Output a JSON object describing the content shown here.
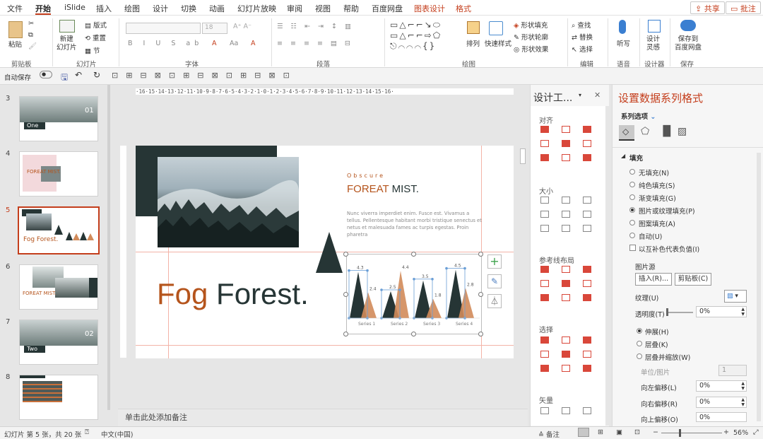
{
  "menu": {
    "tabs": [
      "文件",
      "开始",
      "iSlide",
      "插入",
      "绘图",
      "设计",
      "切换",
      "动画",
      "幻灯片放映",
      "审阅",
      "视图",
      "帮助",
      "百度网盘",
      "图表设计",
      "格式"
    ],
    "active": "开始",
    "share": "共享",
    "comment": "批注"
  },
  "ribbon": {
    "groups": {
      "clipboard": "剪贴板",
      "slides": "幻灯片",
      "font": "字体",
      "paragraph": "段落",
      "drawing": "绘图",
      "editing": "编辑",
      "voice": "语音",
      "designer": "设计器",
      "save": "保存"
    },
    "paste": "粘贴",
    "new_slide": "新建\n幻灯片",
    "layout": "版式",
    "reset": "重置",
    "section": "节",
    "font_size": "18",
    "arrange": "排列",
    "quick_styles": "快速样式",
    "shape_fill": "形状填充",
    "shape_outline": "形状轮廓",
    "shape_effects": "形状效果",
    "find": "查找",
    "replace": "替换",
    "select": "选择",
    "dictate": "听写",
    "design_ideas": "设计\n灵感",
    "save_to": "保存到\n百度网盘"
  },
  "qat": {
    "autosave": "自动保存"
  },
  "slides_panel": {
    "items": [
      {
        "num": "3",
        "label": "One",
        "badge": "01"
      },
      {
        "num": "4",
        "label": "FOREAT MIST."
      },
      {
        "num": "5",
        "label": "Fog Forest.",
        "selected": true
      },
      {
        "num": "6",
        "label": "FOREAT MIST."
      },
      {
        "num": "7",
        "label": "Two",
        "badge": "02"
      },
      {
        "num": "8",
        "label": ""
      }
    ]
  },
  "ruler": {
    "h": "·16·15·14·13·12·11·10·9·8·7·6·5·4·3·2·1·0·1·2·3·4·5·6·7·8·9·10·11·12·13·14·15·16·"
  },
  "slide": {
    "eyebrow": "Obscure",
    "heading_accent": "FOREAT",
    "heading_rest": " MIST.",
    "body": "Nunc viverra imperdiet enim. Fusce est. Vivamus a tellus. Pellentesque habitant morbi tristique senectus et netus et malesuada fames ac turpis egestas. Proin pharetra",
    "title_accent": "Fog",
    "title_rest": " Forest.",
    "colors": {
      "accent": "#b5541c",
      "dark": "#263535",
      "orange": "#d28b5a"
    }
  },
  "chart_data": {
    "type": "area",
    "categories": [
      "Series 1",
      "Series 2",
      "Series 3",
      "Series 4"
    ],
    "series": [
      {
        "values": [
          4.3,
          2.5,
          3.5,
          4.5
        ],
        "color": "#263535"
      },
      {
        "values": [
          2.4,
          4.4,
          1.8,
          2.8
        ],
        "color": "#d28b5a"
      }
    ],
    "ylim": [
      0,
      5
    ]
  },
  "notes": {
    "placeholder": "单击此处添加备注"
  },
  "design_pane": {
    "title": "设计工...",
    "sections": [
      "对齐",
      "大小",
      "参考线布局",
      "选择",
      "矢量"
    ]
  },
  "format_pane": {
    "title": "设置数据系列格式",
    "subtitle": "系列选项",
    "fill_header": "填充",
    "fill_options": [
      "无填充(N)",
      "纯色填充(S)",
      "渐变填充(G)",
      "图片或纹理填充(P)",
      "图案填充(A)",
      "自动(U)"
    ],
    "fill_selected": 3,
    "invert": "以互补色代表负值(I)",
    "picture_source": "图片源",
    "insert_btn": "插入(R)...",
    "clipboard_btn": "剪贴板(C)",
    "texture": "纹理(U)",
    "transparency": "透明度(T)",
    "transparency_val": "0%",
    "stretch_options": [
      "伸展(H)",
      "层叠(K)",
      "层叠并缩放(W)"
    ],
    "stretch_selected": 0,
    "unit_label": "单位/图片",
    "unit_val": "1",
    "offset_left": "向左偏移(L)",
    "offset_left_val": "0%",
    "offset_right": "向右偏移(R)",
    "offset_right_val": "0%",
    "offset_top": "向上偏移(O)",
    "offset_top_val": "0%"
  },
  "status": {
    "slide_info": "幻灯片 第 5 张，共 20 张",
    "language": "中文(中国)",
    "notes_btn": "备注",
    "zoom": "56%"
  }
}
